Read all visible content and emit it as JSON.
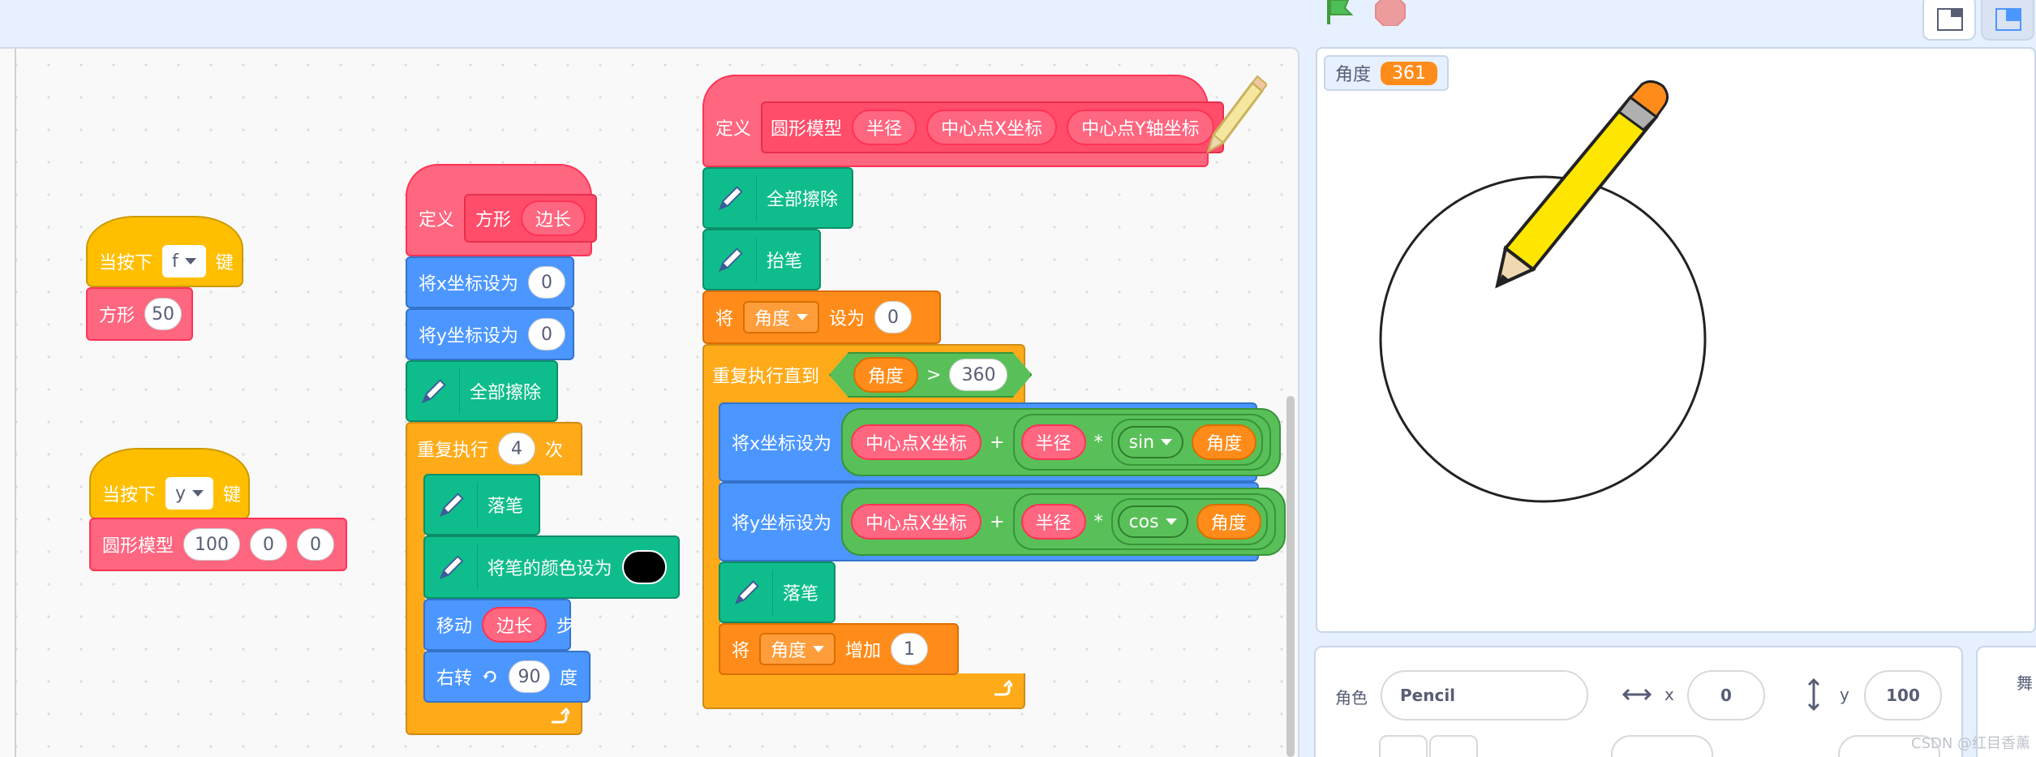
{
  "toolbar": {
    "green_flag": "green-flag-icon",
    "stop": "stop-icon"
  },
  "colors": {
    "events": "#ffbf00",
    "my_blocks": "#ff6680",
    "motion": "#4c97ff",
    "pen": "#0fbd8c",
    "control": "#ffab19",
    "variables": "#ff8c1a",
    "operators": "#59c059"
  },
  "scripts": {
    "s1": {
      "hat": "当按下",
      "key": "f",
      "key_suffix": "键",
      "call": "方形",
      "arg": "50"
    },
    "s2": {
      "hat": "当按下",
      "key": "y",
      "key_suffix": "键",
      "call": "圆形模型",
      "args": [
        "100",
        "0",
        "0"
      ]
    },
    "s3": {
      "define": "定义",
      "name": "方形",
      "param": "边长",
      "setx": "将x坐标设为",
      "setx_val": "0",
      "sety": "将y坐标设为",
      "sety_val": "0",
      "clear": "全部擦除",
      "repeat": "重复执行",
      "repeat_n": "4",
      "repeat_suffix": "次",
      "pendown": "落笔",
      "setcolor": "将笔的颜色设为",
      "move": "移动",
      "move_param": "边长",
      "move_suffix": "步",
      "turn": "右转",
      "turn_val": "90",
      "turn_suffix": "度"
    },
    "s4": {
      "define": "定义",
      "name": "圆形模型",
      "params": [
        "半径",
        "中心点X坐标",
        "中心点Y轴坐标"
      ],
      "clear": "全部擦除",
      "penup": "抬笔",
      "set": "将",
      "var": "角度",
      "set_to": "设为",
      "set_val": "0",
      "until": "重复执行直到",
      "cond_var": "角度",
      "cond_op": ">",
      "cond_val": "360",
      "setx": "将x坐标设为",
      "sety": "将y坐标设为",
      "cx": "中心点X坐标",
      "plus": "+",
      "r": "半径",
      "times": "*",
      "sin": "sin",
      "cos": "cos",
      "angle": "角度",
      "pendown": "落笔",
      "change": "将",
      "change_var": "角度",
      "change_by": "增加",
      "change_val": "1"
    }
  },
  "stage": {
    "monitor_label": "角度",
    "monitor_value": "361"
  },
  "sprite": {
    "label": "角色",
    "name": "Pencil",
    "x_label": "x",
    "x": "0",
    "y_label": "y",
    "y": "100"
  },
  "backdrop": {
    "label": "舞"
  },
  "watermark": "CSDN @红目香薰"
}
